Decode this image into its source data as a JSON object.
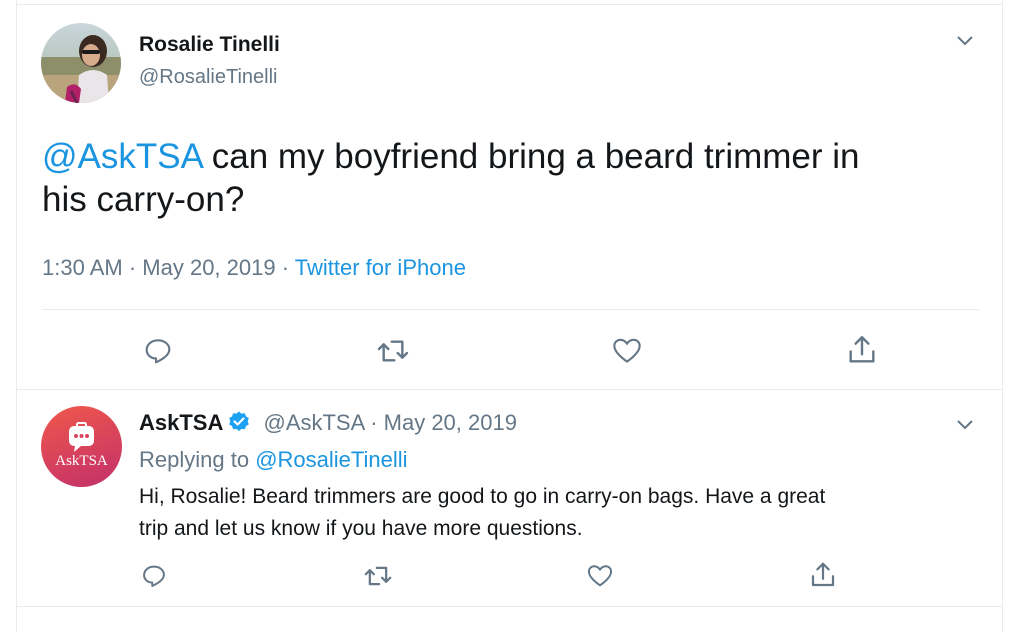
{
  "tweet": {
    "author_name": "Rosalie Tinelli",
    "author_handle": "@RosalieTinelli",
    "mention": "@AskTSA",
    "text_line1": " can my boyfriend bring a beard trimmer in",
    "text_line2": "his carry-on?",
    "time": "1:30 AM",
    "sep1": " · ",
    "date": "May 20, 2019",
    "sep2": " · ",
    "source": "Twitter for iPhone",
    "icons": [
      "reply-icon",
      "retweet-icon",
      "like-icon",
      "share-icon"
    ]
  },
  "reply": {
    "author_name": "AskTSA",
    "author_handle": "@AskTSA",
    "sep": " · ",
    "date": "May 20, 2019",
    "replying_prefix": "Replying to ",
    "replying_to": "@RosalieTinelli",
    "text_line1": "Hi, Rosalie! Beard trimmers are good to go in carry-on bags. Have a great",
    "text_line2": "trip and let us know if you have more questions.",
    "avatar_label": "AskTSA",
    "icons": [
      "reply-icon",
      "retweet-icon",
      "like-icon",
      "share-icon"
    ]
  },
  "colors": {
    "link": "#1b95e0",
    "muted": "#657786",
    "text": "#14171a",
    "verified": "#1da1f2",
    "asktsa_gradient_start": "#f0584a",
    "asktsa_gradient_end": "#c2306b"
  }
}
